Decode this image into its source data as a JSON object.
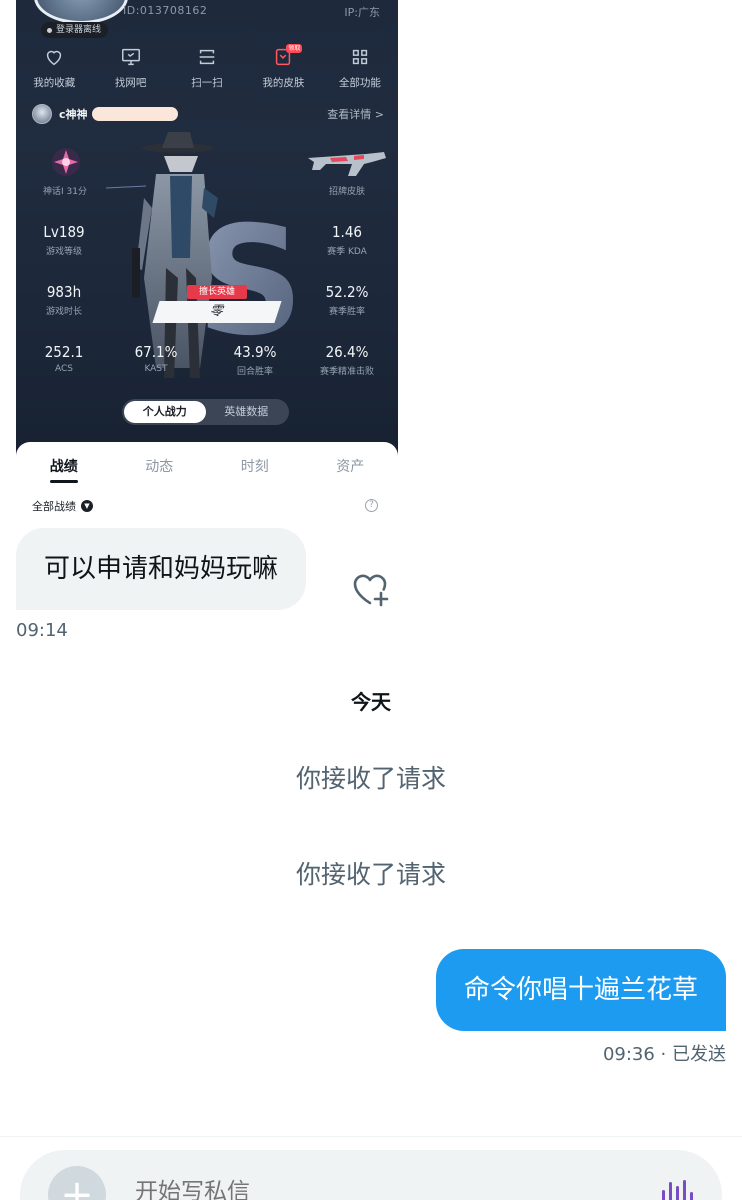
{
  "shared_card": {
    "id_text": "ID:013708162",
    "ip_text": "IP:广东",
    "offline_badge": "登录器离线",
    "functions": [
      {
        "label": "我的收藏",
        "icon": "heart-icon"
      },
      {
        "label": "找网吧",
        "icon": "monitor-icon"
      },
      {
        "label": "扫一扫",
        "icon": "scan-icon"
      },
      {
        "label": "我的皮肤",
        "icon": "skin-icon",
        "badge": "领取"
      },
      {
        "label": "全部功能",
        "icon": "grid-icon"
      }
    ],
    "player_name": "c神神",
    "detail_link": "查看详情 >",
    "rank_label": "神话Ⅰ 31分",
    "skin_label": "招牌皮肤",
    "stats": {
      "level": {
        "value": "Lv189",
        "label": "游戏等级"
      },
      "kda": {
        "value": "1.46",
        "label": "赛季 KDA"
      },
      "hours": {
        "value": "983h",
        "label": "游戏时长"
      },
      "winrate": {
        "value": "52.2%",
        "label": "赛季胜率"
      },
      "acs": {
        "value": "252.1",
        "label": "ACS"
      },
      "kast": {
        "value": "67.1%",
        "label": "KAST"
      },
      "round_win": {
        "value": "43.9%",
        "label": "回合胜率"
      },
      "precision": {
        "value": "26.4%",
        "label": "赛季精准击败"
      }
    },
    "hero_tag": "擅长英雄",
    "hero_name": "零",
    "segments": [
      "个人战力",
      "英雄数据"
    ],
    "tabs": [
      "战绩",
      "动态",
      "时刻",
      "资产"
    ],
    "filter_label": "全部战绩",
    "help_icon": "?"
  },
  "chat": {
    "incoming_message": "可以申请和妈妈玩嘛",
    "incoming_time": "09:14",
    "date_separator": "今天",
    "system_messages": [
      "你接收了请求",
      "你接收了请求"
    ],
    "outgoing_message": "命令你唱十遍兰花草",
    "outgoing_status": "09:36 · 已发送",
    "accent_color": "#1d9bf0"
  },
  "composer": {
    "placeholder": "开始写私信"
  }
}
